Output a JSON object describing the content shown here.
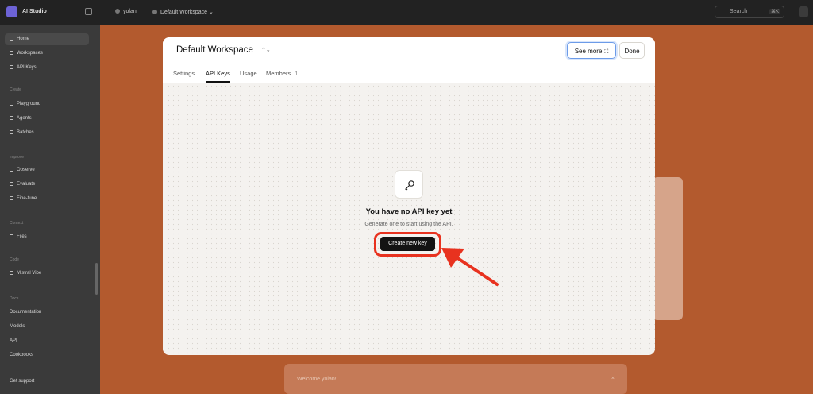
{
  "topbar": {
    "app_name": "AI Studio",
    "breadcrumb": [
      "yolan",
      "Default Workspace"
    ],
    "search_placeholder": "Search",
    "search_shortcut": "⌘K"
  },
  "sidebar": {
    "main_items": [
      "Home",
      "Workspaces",
      "API Keys"
    ],
    "sections": [
      {
        "label": "Create",
        "items": [
          "Playground",
          "Agents",
          "Batches"
        ]
      },
      {
        "label": "Improve",
        "items": [
          "Observe",
          "Evaluate",
          "Fine-tune"
        ]
      },
      {
        "label": "Context",
        "items": [
          "Files"
        ]
      },
      {
        "label": "Code",
        "items": [
          "Mistral Vibe"
        ]
      },
      {
        "label": "Docs",
        "items": [
          "Documentation",
          "Models",
          "API",
          "Cookbooks"
        ]
      }
    ],
    "footer": "Get support"
  },
  "modal": {
    "title": "Default Workspace",
    "see_more": "See more",
    "done": "Done",
    "tabs": [
      {
        "label": "Settings",
        "active": false
      },
      {
        "label": "API Keys",
        "active": true
      },
      {
        "label": "Usage",
        "active": false
      },
      {
        "label": "Members",
        "count": "1",
        "active": false
      }
    ],
    "empty_state": {
      "icon": "key-icon",
      "heading": "You have no API key yet",
      "subtext": "Generate one to start using the API.",
      "button": "Create new key"
    }
  },
  "background": {
    "banner_text": "Welcome yolan!",
    "banner_close": "×"
  },
  "colors": {
    "accent_background": "#b35a2e",
    "highlight": "#e8321f",
    "primary_button": "#131313",
    "focus_ring": "#6c9be8"
  }
}
